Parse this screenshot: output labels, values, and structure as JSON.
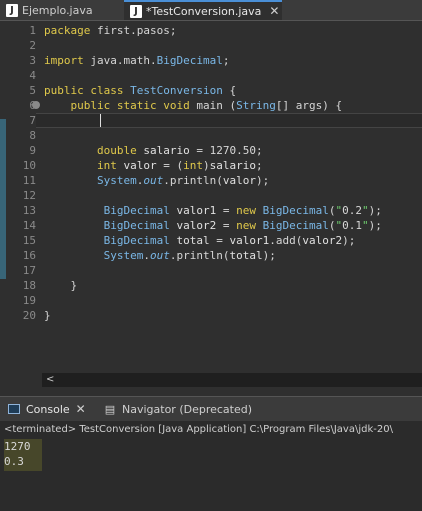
{
  "tabs": [
    {
      "label": "Ejemplo.java",
      "active": false
    },
    {
      "label": "*TestConversion.java",
      "active": true
    }
  ],
  "tab_close": "✕",
  "editor": {
    "line_numbers": [
      "1",
      "2",
      "3",
      "4",
      "5",
      "6",
      "7",
      "8",
      "9",
      "10",
      "11",
      "12",
      "13",
      "14",
      "15",
      "16",
      "17",
      "18",
      "19",
      "20"
    ],
    "lines": [
      "package first.pasos;",
      "",
      "import java.math.BigDecimal;",
      "",
      "public class TestConversion {",
      "    public static void main (String[] args) {",
      "        ",
      "",
      "        double salario = 1270.50;",
      "        int valor = (int)salario;",
      "        System.out.println(valor);",
      "",
      "         BigDecimal valor1 = new BigDecimal(\"0.2\");",
      "         BigDecimal valor2 = new BigDecimal(\"0.1\");",
      "         BigDecimal total = valor1.add(valor2);",
      "         System.out.println(total);",
      "",
      "    }",
      "",
      "}"
    ]
  },
  "scrollbar": {
    "left_arrow": "<"
  },
  "panel": {
    "console_label": "Console",
    "navigator_label": "Navigator (Deprecated)",
    "close": "✕",
    "status": "<terminated> TestConversion [Java Application] C:\\Program Files\\Java\\jdk-20\\",
    "output": [
      "1270",
      "0.3"
    ]
  },
  "colors": {
    "accent": "#4a8fd6",
    "change_bar": "#3a6e85",
    "highlight": "#6b6b2a"
  }
}
